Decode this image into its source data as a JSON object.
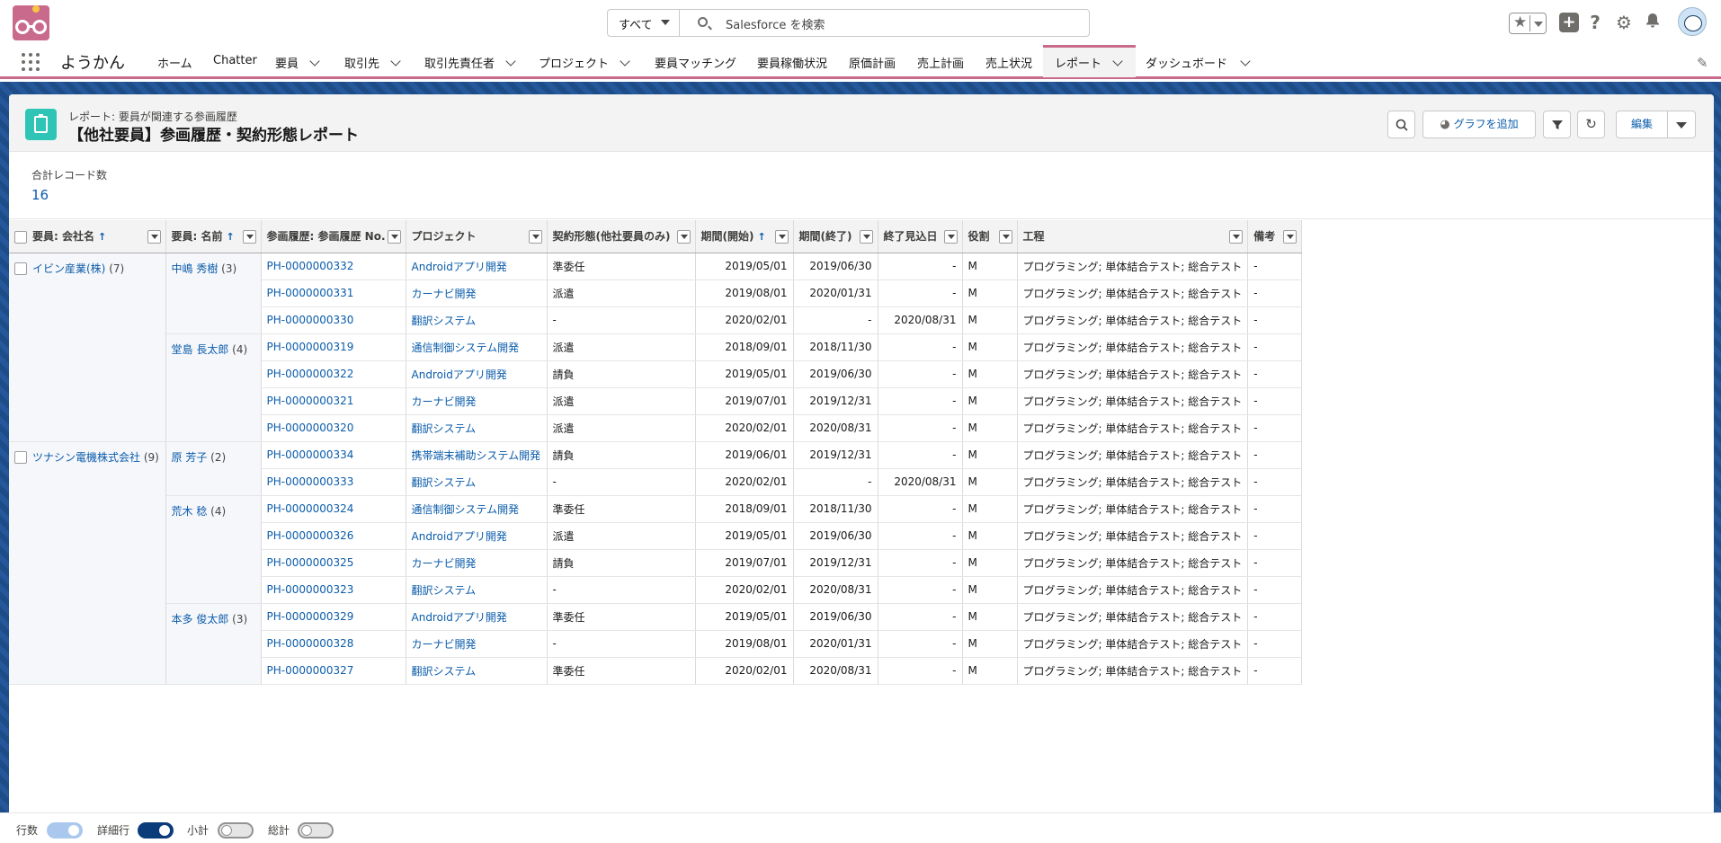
{
  "global_header": {
    "search_scope": "すべて",
    "search_placeholder": "Salesforce を検索"
  },
  "nav": {
    "app_name": "ようかん",
    "items": [
      {
        "label": "ホーム",
        "has_menu": false
      },
      {
        "label": "Chatter",
        "has_menu": false
      },
      {
        "label": "要員",
        "has_menu": true
      },
      {
        "label": "取引先",
        "has_menu": true
      },
      {
        "label": "取引先責任者",
        "has_menu": true
      },
      {
        "label": "プロジェクト",
        "has_menu": true
      },
      {
        "label": "要員マッチング",
        "has_menu": false
      },
      {
        "label": "要員稼働状況",
        "has_menu": false
      },
      {
        "label": "原価計画",
        "has_menu": false
      },
      {
        "label": "売上計画",
        "has_menu": false
      },
      {
        "label": "売上状況",
        "has_menu": false
      },
      {
        "label": "レポート",
        "has_menu": true,
        "active": true
      },
      {
        "label": "ダッシュボード",
        "has_menu": true
      }
    ]
  },
  "report": {
    "subtitle": "レポート: 要員が関連する参画履歴",
    "title": "【他社要員】参画履歴・契約形態レポート",
    "add_chart_label": "グラフを追加",
    "edit_label": "編集",
    "total_label": "合計レコード数",
    "total_value": "16"
  },
  "table": {
    "headers": [
      "要員: 会社名",
      "要員: 名前",
      "参画履歴: 参画履歴 No.",
      "プロジェクト",
      "契約形態(他社要員のみ)",
      "期間(開始)",
      "期間(終了)",
      "終了見込日",
      "役割",
      "工程",
      "備考"
    ],
    "groups": [
      {
        "company": "イビン産業(株)",
        "count": "(7)",
        "people": [
          {
            "name": "中嶋 秀樹",
            "count": "(3)",
            "rows": [
              [
                "PH-0000000332",
                "Androidアプリ開発",
                "準委任",
                "2019/05/01",
                "2019/06/30",
                "-",
                "M",
                "プログラミング; 単体結合テスト; 総合テスト",
                "-"
              ],
              [
                "PH-0000000331",
                "カーナビ開発",
                "派遣",
                "2019/08/01",
                "2020/01/31",
                "-",
                "M",
                "プログラミング; 単体結合テスト; 総合テスト",
                "-"
              ],
              [
                "PH-0000000330",
                "翻訳システム",
                "-",
                "2020/02/01",
                "-",
                "2020/08/31",
                "M",
                "プログラミング; 単体結合テスト; 総合テスト",
                "-"
              ]
            ]
          },
          {
            "name": "堂島 長太郎",
            "count": "(4)",
            "rows": [
              [
                "PH-0000000319",
                "通信制御システム開発",
                "派遣",
                "2018/09/01",
                "2018/11/30",
                "-",
                "M",
                "プログラミング; 単体結合テスト; 総合テスト",
                "-"
              ],
              [
                "PH-0000000322",
                "Androidアプリ開発",
                "請負",
                "2019/05/01",
                "2019/06/30",
                "-",
                "M",
                "プログラミング; 単体結合テスト; 総合テスト",
                "-"
              ],
              [
                "PH-0000000321",
                "カーナビ開発",
                "派遣",
                "2019/07/01",
                "2019/12/31",
                "-",
                "M",
                "プログラミング; 単体結合テスト; 総合テスト",
                "-"
              ],
              [
                "PH-0000000320",
                "翻訳システム",
                "派遣",
                "2020/02/01",
                "2020/08/31",
                "-",
                "M",
                "プログラミング; 単体結合テスト; 総合テスト",
                "-"
              ]
            ]
          }
        ]
      },
      {
        "company": "ツナシン電機株式会社",
        "count": "(9)",
        "people": [
          {
            "name": "原 芳子",
            "count": "(2)",
            "rows": [
              [
                "PH-0000000334",
                "携帯端末補助システム開発",
                "請負",
                "2019/06/01",
                "2019/12/31",
                "-",
                "M",
                "プログラミング; 単体結合テスト; 総合テスト",
                "-"
              ],
              [
                "PH-0000000333",
                "翻訳システム",
                "-",
                "2020/02/01",
                "-",
                "2020/08/31",
                "M",
                "プログラミング; 単体結合テスト; 総合テスト",
                "-"
              ]
            ]
          },
          {
            "name": "荒木 稔",
            "count": "(4)",
            "rows": [
              [
                "PH-0000000324",
                "通信制御システム開発",
                "準委任",
                "2018/09/01",
                "2018/11/30",
                "-",
                "M",
                "プログラミング; 単体結合テスト; 総合テスト",
                "-"
              ],
              [
                "PH-0000000326",
                "Androidアプリ開発",
                "派遣",
                "2019/05/01",
                "2019/06/30",
                "-",
                "M",
                "プログラミング; 単体結合テスト; 総合テスト",
                "-"
              ],
              [
                "PH-0000000325",
                "カーナビ開発",
                "請負",
                "2019/07/01",
                "2019/12/31",
                "-",
                "M",
                "プログラミング; 単体結合テスト; 総合テスト",
                "-"
              ],
              [
                "PH-0000000323",
                "翻訳システム",
                "-",
                "2020/02/01",
                "2020/08/31",
                "-",
                "M",
                "プログラミング; 単体結合テスト; 総合テスト",
                "-"
              ]
            ]
          },
          {
            "name": "本多 俊太郎",
            "count": "(3)",
            "rows": [
              [
                "PH-0000000329",
                "Androidアプリ開発",
                "準委任",
                "2019/05/01",
                "2019/06/30",
                "-",
                "M",
                "プログラミング; 単体結合テスト; 総合テスト",
                "-"
              ],
              [
                "PH-0000000328",
                "カーナビ開発",
                "-",
                "2019/08/01",
                "2020/01/31",
                "-",
                "M",
                "プログラミング; 単体結合テスト; 総合テスト",
                "-"
              ],
              [
                "PH-0000000327",
                "翻訳システム",
                "準委任",
                "2020/02/01",
                "2020/08/31",
                "-",
                "M",
                "プログラミング; 単体結合テスト; 総合テスト",
                "-"
              ]
            ]
          }
        ]
      }
    ]
  },
  "footer": {
    "toggles": [
      {
        "label": "行数",
        "state": "on-disabled"
      },
      {
        "label": "詳細行",
        "state": "on"
      },
      {
        "label": "小計",
        "state": "off"
      },
      {
        "label": "総計",
        "state": "off"
      }
    ]
  },
  "colors": {
    "brand_pink": "#c96a8c",
    "link_blue": "#0b5cab",
    "report_icon_teal": "#2ec4b6",
    "background_navy": "#1d4c88"
  }
}
